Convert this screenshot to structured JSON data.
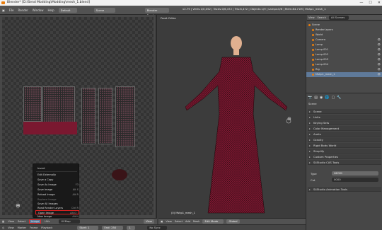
{
  "titlebar": {
    "title": "Blender* [D:\\Send Modding\\Modding\\mesh_1.blend]",
    "minimize": "—",
    "maximize": "☐",
    "close": "✕"
  },
  "menubar": {
    "items": [
      "File",
      "Render",
      "Window",
      "Help"
    ],
    "layout": "Default",
    "scene": "Scene",
    "engine": "Blender Render",
    "stats": "v2.79 | Verts:1/0,052 | Faces:0/6,472 | Tris:8,472 | Objects:1/9 | Lamps:0/6 | Mem:84.71M | Mshp1_mesh_1",
    "view_label": "View",
    "search_label": "Search",
    "all_scenes": "All Scenes"
  },
  "view3d": {
    "label": "Front Ortho",
    "object_label": "(0) Mshp1_mesh_1"
  },
  "outliner": {
    "rows": [
      {
        "label": "Scene",
        "selected": false
      },
      {
        "label": "RenderLayers",
        "selected": false
      },
      {
        "label": "World",
        "selected": false
      },
      {
        "label": "Camera",
        "selected": false
      },
      {
        "label": "Lamp",
        "selected": false
      },
      {
        "label": "Lamp.001",
        "selected": false
      },
      {
        "label": "Lamp.002",
        "selected": false
      },
      {
        "label": "Lamp.003",
        "selected": false
      },
      {
        "label": "Lamp.004",
        "selected": false
      },
      {
        "label": "Rig",
        "selected": false
      },
      {
        "label": "Mshp1_mesh_1",
        "selected": true
      }
    ]
  },
  "properties": {
    "breadcrumb": "Scene",
    "panels": [
      "Scene",
      "Units",
      "Keying Sets",
      "Color Management",
      "Audio",
      "Gravity",
      "Rigid Body World",
      "Simplify",
      "Custom Properties",
      "S4Studio CAS Tools"
    ],
    "type_label": "Type",
    "type_value": "GEOM",
    "cut_label": "Cut",
    "cut_value": "0000",
    "anim_panel": "S4Studio Animation Tools"
  },
  "context_menu": {
    "items": [
      {
        "label": "Invert",
        "shortcut": "",
        "disabled": false
      },
      {
        "label": "Edit Externally",
        "shortcut": "",
        "disabled": false
      },
      {
        "label": "Save a Copy",
        "shortcut": "",
        "disabled": false
      },
      {
        "label": "Save As Image",
        "shortcut": "F3",
        "disabled": false
      },
      {
        "label": "Save Image",
        "shortcut": "Alt S",
        "disabled": false
      },
      {
        "label": "Reload Image",
        "shortcut": "Alt R",
        "disabled": false
      },
      {
        "label": "Replace Image",
        "shortcut": "",
        "disabled": true
      },
      {
        "label": "Save All Images",
        "shortcut": "",
        "disabled": false
      },
      {
        "label": "Read Render Layers",
        "shortcut": "Ctrl R",
        "disabled": false
      },
      {
        "label": "Open Image",
        "shortcut": "Alt O",
        "disabled": false,
        "highlighted": true
      },
      {
        "label": "New Image",
        "shortcut": "Alt N",
        "disabled": false
      }
    ]
  },
  "uv_header": {
    "items": [
      "View",
      "Select",
      "Image",
      "UVs"
    ],
    "image_highlighted": "Image",
    "uvmap": "UVMap",
    "view": "View"
  },
  "view_header": {
    "items": [
      "View",
      "Select",
      "Add",
      "Mesh"
    ],
    "mode": "Edit Mode",
    "pivot": "Global"
  },
  "timeline": {
    "items": [
      "View",
      "Marker",
      "Frame",
      "Playback"
    ],
    "start_label": "Start:",
    "start": "1",
    "end_label": "End:",
    "end": "250",
    "current": "1",
    "sync": "No Sync"
  },
  "colors": {
    "accent": "#e87d0d",
    "selection": "#5f7a9a",
    "highlight_box": "#e02020",
    "dress": "#7a1830"
  }
}
